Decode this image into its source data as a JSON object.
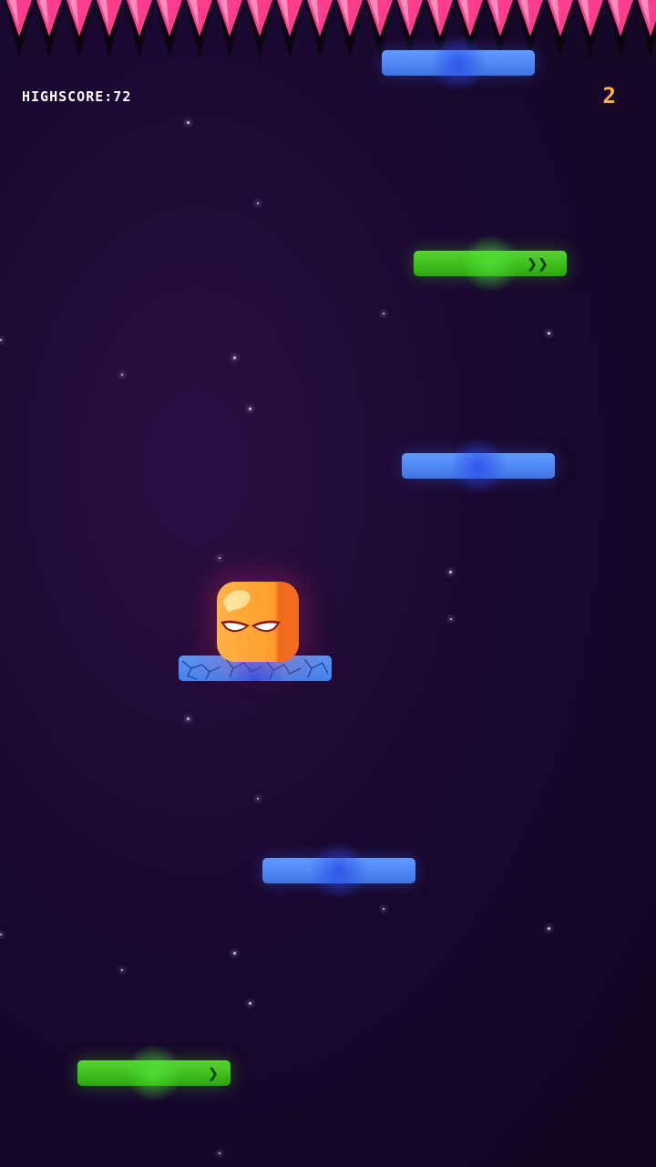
{
  "hud": {
    "highscore_text": "HIGHSCORE:72",
    "score_text": "2"
  },
  "colors": {
    "background": "#1a0830",
    "spike_pink": "#ff3d8c",
    "spike_dark": "#0b0510",
    "platform_blue": "#4f87f4",
    "platform_green": "#3fbf1c",
    "player_orange": "#ffa12e",
    "score_orange": "#ffb13b"
  },
  "hazard": {
    "type": "ceiling-spikes",
    "icon": "spike-row-icon"
  },
  "player": {
    "icon": "orange-cube-angry-eyes-icon"
  },
  "platforms": [
    {
      "kind": "normal",
      "color": "blue"
    },
    {
      "kind": "moving",
      "color": "green",
      "direction": "right",
      "speed_arrows": 2
    },
    {
      "kind": "normal",
      "color": "blue"
    },
    {
      "kind": "cracked",
      "color": "blue"
    },
    {
      "kind": "normal",
      "color": "blue"
    },
    {
      "kind": "moving",
      "color": "green",
      "direction": "right",
      "speed_arrows": 1
    }
  ]
}
